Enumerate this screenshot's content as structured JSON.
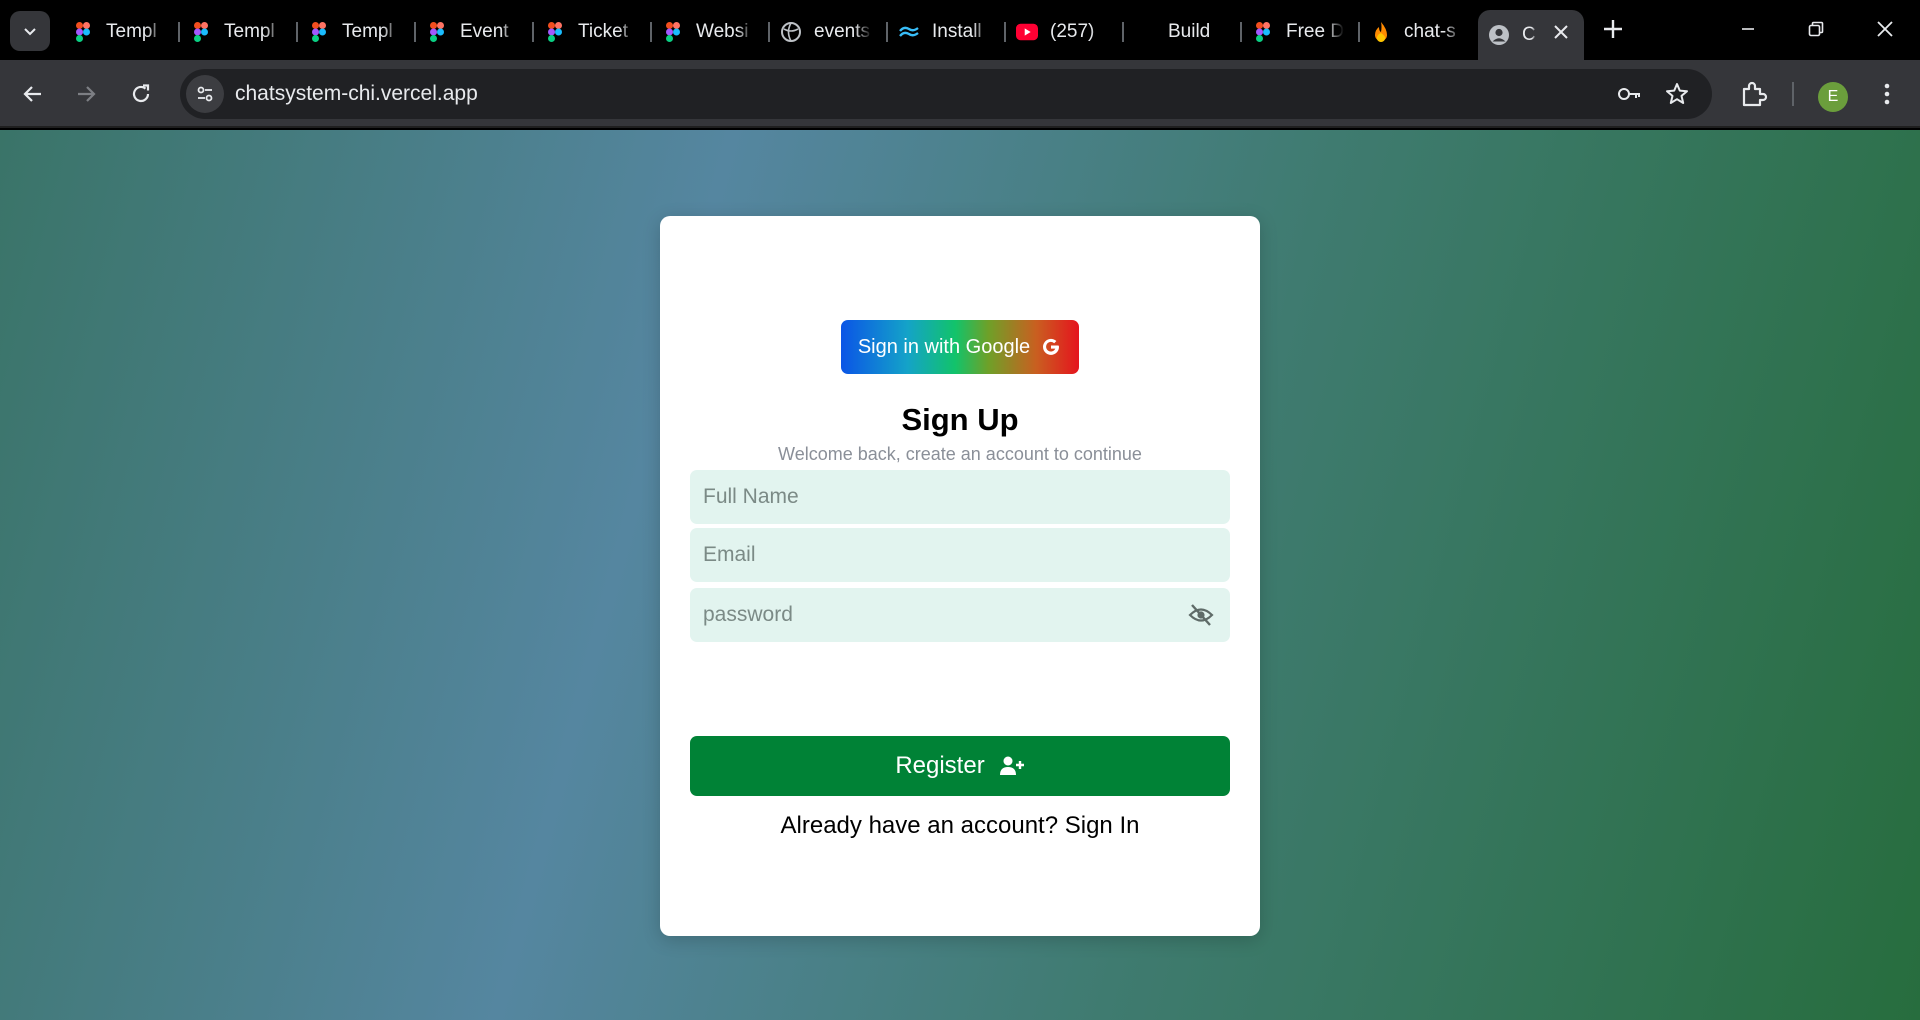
{
  "browser": {
    "tabs": [
      {
        "title": "Templ",
        "favicon": "figma-icon"
      },
      {
        "title": "Templ",
        "favicon": "figma-icon"
      },
      {
        "title": "Templ",
        "favicon": "figma-icon"
      },
      {
        "title": "Event",
        "favicon": "figma-icon"
      },
      {
        "title": "Ticket",
        "favicon": "figma-icon"
      },
      {
        "title": "Websi",
        "favicon": "figma-icon"
      },
      {
        "title": "events",
        "favicon": "globe-icon"
      },
      {
        "title": "Install",
        "favicon": "tailwind-icon"
      },
      {
        "title": "(257)",
        "favicon": "youtube-icon"
      },
      {
        "title": "Build",
        "favicon": "none"
      },
      {
        "title": "Free D",
        "favicon": "figma-icon"
      },
      {
        "title": "chat-s",
        "favicon": "firebase-icon"
      },
      {
        "title": "C",
        "favicon": "user-icon",
        "active": true
      }
    ],
    "url": "chatsystem-chi.vercel.app",
    "profile_initial": "E",
    "colors": {
      "profile": "#6b9e3c",
      "tabstrip": "#000000",
      "toolbar": "#35363a"
    }
  },
  "page": {
    "google_button_label": "Sign in with Google",
    "heading": "Sign Up",
    "subheading": "Welcome back, create an account to continue",
    "fields": {
      "full_name_placeholder": "Full Name",
      "email_placeholder": "Email",
      "password_placeholder": "password"
    },
    "register_label": "Register",
    "signin_prompt": "Already have an account?",
    "signin_link": "Sign In",
    "colors": {
      "register": "#008236",
      "field_bg": "#e2f4ef",
      "subheading": "#8a8f98"
    }
  }
}
